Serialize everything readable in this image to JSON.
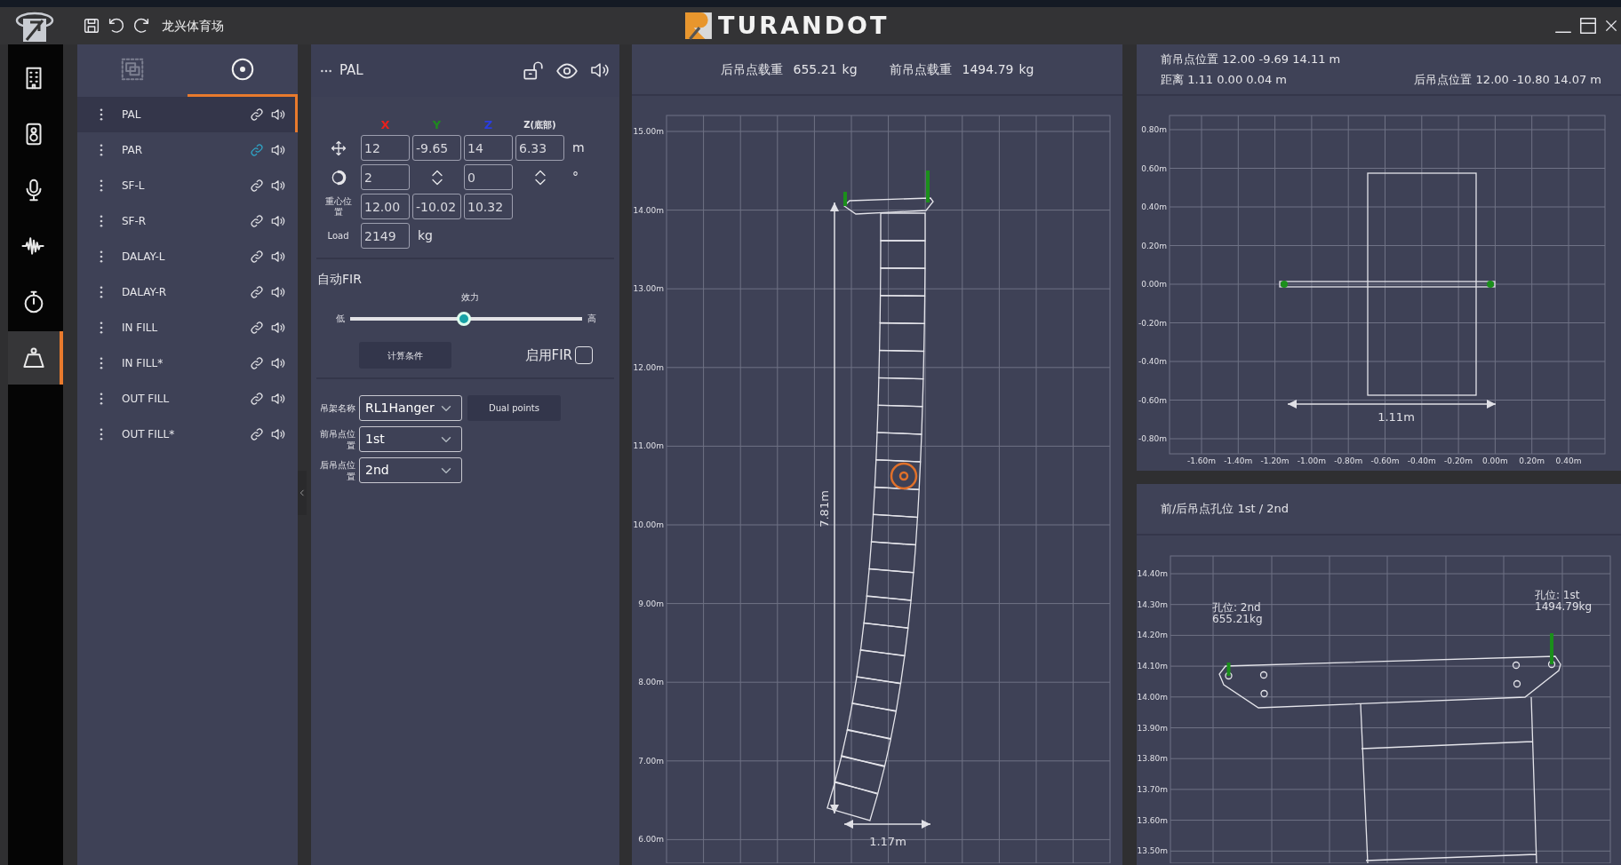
{
  "top_bar": {
    "project_title": "龙兴体育场",
    "brand": "TURANDOT"
  },
  "rail": [
    {
      "kind": "building",
      "selected": false
    },
    {
      "kind": "speaker",
      "selected": false
    },
    {
      "kind": "microphone",
      "selected": false
    },
    {
      "kind": "waveform",
      "selected": false
    },
    {
      "kind": "stopwatch",
      "selected": false
    },
    {
      "kind": "weight",
      "selected": true
    }
  ],
  "list_tabs": [
    {
      "kind": "layers",
      "selected": false
    },
    {
      "kind": "target",
      "selected": true
    }
  ],
  "arrays": [
    {
      "name": "PAL",
      "selected": true,
      "linked": false
    },
    {
      "name": "PAR",
      "selected": false,
      "linked": true
    },
    {
      "name": "SF-L",
      "selected": false,
      "linked": false
    },
    {
      "name": "SF-R",
      "selected": false,
      "linked": false
    },
    {
      "name": "DALAY-L",
      "selected": false,
      "linked": false
    },
    {
      "name": "DALAY-R",
      "selected": false,
      "linked": false
    },
    {
      "name": "IN FILL",
      "selected": false,
      "linked": false
    },
    {
      "name": "IN FILL*",
      "selected": false,
      "linked": false
    },
    {
      "name": "OUT FILL",
      "selected": false,
      "linked": false
    },
    {
      "name": "OUT FILL*",
      "selected": false,
      "linked": false
    }
  ],
  "properties": {
    "title": "PAL",
    "axis_labels": [
      {
        "text": "X",
        "color": "#e8201c"
      },
      {
        "text": "Y",
        "color": "#1f8a1f"
      },
      {
        "text": "Z",
        "color": "#2a3de0"
      },
      {
        "text": "Z(底部)",
        "color": "#e6e6ea"
      }
    ],
    "position": {
      "values": [
        "12",
        "-9.65",
        "14",
        "6.33"
      ],
      "unit": "m"
    },
    "rotation": {
      "values": [
        "2",
        "0"
      ],
      "unit": "°"
    },
    "center_of_gravity": {
      "label": "重心位置",
      "values": [
        "12.00",
        "-10.02",
        "10.32"
      ]
    },
    "load": {
      "label": "Load",
      "value": "2149",
      "unit": "kg"
    },
    "fir": {
      "title": "自动FIR",
      "slider_label": "效力",
      "low": "低",
      "high": "高",
      "level": 0.49,
      "calc_button": "计算条件",
      "enable_label": "启用FIR",
      "enabled": false
    },
    "hanger": {
      "name_label": "吊架名称",
      "name": "RL1Hanger",
      "dual_button": "Dual points",
      "front_label": "前吊点位置",
      "front": "1st",
      "rear_label": "后吊点位置",
      "rear": "2nd"
    }
  },
  "load_panel": {
    "loads": [
      {
        "label": "后吊点载重",
        "value": "655.21",
        "unit": "kg"
      },
      {
        "label": "前吊点载重",
        "value": "1494.79",
        "unit": "kg"
      }
    ],
    "chart": {
      "y_ticks": [
        "15.00m",
        "14.00m",
        "13.00m",
        "12.00m",
        "11.00m",
        "10.00m",
        "9.00m",
        "8.00m",
        "7.00m",
        "6.00m"
      ],
      "height_label": "7.81m",
      "width_label": "1.17m"
    }
  },
  "plan_panel": {
    "front_position": "前吊点位置 12.00 -9.69 14.11 m",
    "distance": "距离 1.11 0.00 0.04 m",
    "rear_position": "后吊点位置 12.00 -10.80 14.07 m",
    "chart": {
      "y_ticks": [
        "0.80m",
        "0.60m",
        "0.40m",
        "0.20m",
        "0.00m",
        "-0.20m",
        "-0.40m",
        "-0.60m",
        "-0.80m"
      ],
      "x_ticks": [
        "-1.60m",
        "-1.40m",
        "-1.20m",
        "-1.00m",
        "-0.80m",
        "-0.60m",
        "-0.40m",
        "-0.20m",
        "0.00m",
        "0.20m",
        "0.40m"
      ],
      "width_label": "1.11m"
    }
  },
  "hole_panel": {
    "title": "前/后吊点孔位 1st / 2nd",
    "chart": {
      "y_ticks": [
        "14.40m",
        "14.30m",
        "14.20m",
        "14.10m",
        "14.00m",
        "13.90m",
        "13.80m",
        "13.70m",
        "13.60m",
        "13.50m"
      ],
      "rear_point": {
        "hole": "孔位: 2nd",
        "load": "655.21kg"
      },
      "front_point": {
        "hole": "孔位: 1st",
        "load": "1494.79kg"
      }
    }
  }
}
